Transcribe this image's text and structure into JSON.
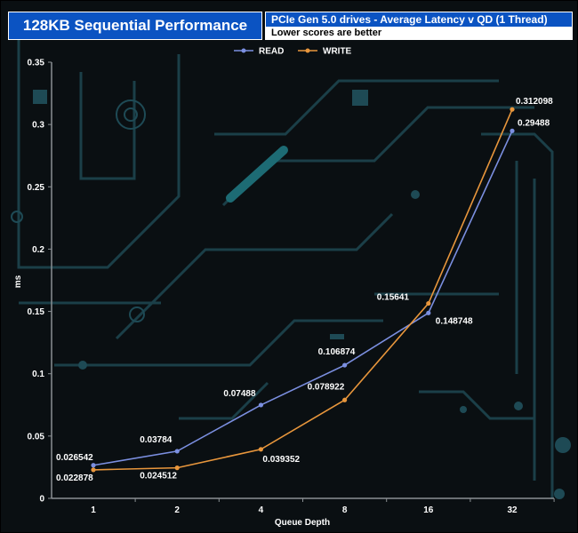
{
  "header": {
    "title": "128KB Sequential Performance",
    "subtitle": "PCIe Gen 5.0 drives - Average Latency v QD (1 Thread)",
    "note": "Lower scores are better"
  },
  "colors": {
    "read": "#7b8fe0",
    "write": "#e8963c",
    "title_bg": "#0b53c2",
    "background": "#0a0f12",
    "circuit": "#1e4a55"
  },
  "chart_data": {
    "type": "line",
    "title": "128KB Sequential Performance",
    "subtitle": "PCIe Gen 5.0 drives - Average Latency v QD (1 Thread)",
    "xlabel": "Queue Depth",
    "ylabel": "ms",
    "categories": [
      "1",
      "2",
      "4",
      "8",
      "16",
      "32"
    ],
    "ylim": [
      0,
      0.35
    ],
    "yticks": [
      "0",
      "0.05",
      "0.1",
      "0.15",
      "0.2",
      "0.25",
      "0.3",
      "0.35"
    ],
    "legend_position": "top-center",
    "grid": false,
    "series": [
      {
        "name": "READ",
        "values": [
          0.026542,
          0.03784,
          0.07488,
          0.106874,
          0.148748,
          0.29488
        ],
        "labels": [
          "0.026542",
          "0.03784",
          "0.07488",
          "0.106874",
          "0.148748",
          "0.29488"
        ]
      },
      {
        "name": "WRITE",
        "values": [
          0.022878,
          0.024512,
          0.039352,
          0.078922,
          0.15641,
          0.312098
        ],
        "labels": [
          "0.022878",
          "0.024512",
          "0.039352",
          "0.078922",
          "0.15641",
          "0.312098"
        ]
      }
    ]
  }
}
